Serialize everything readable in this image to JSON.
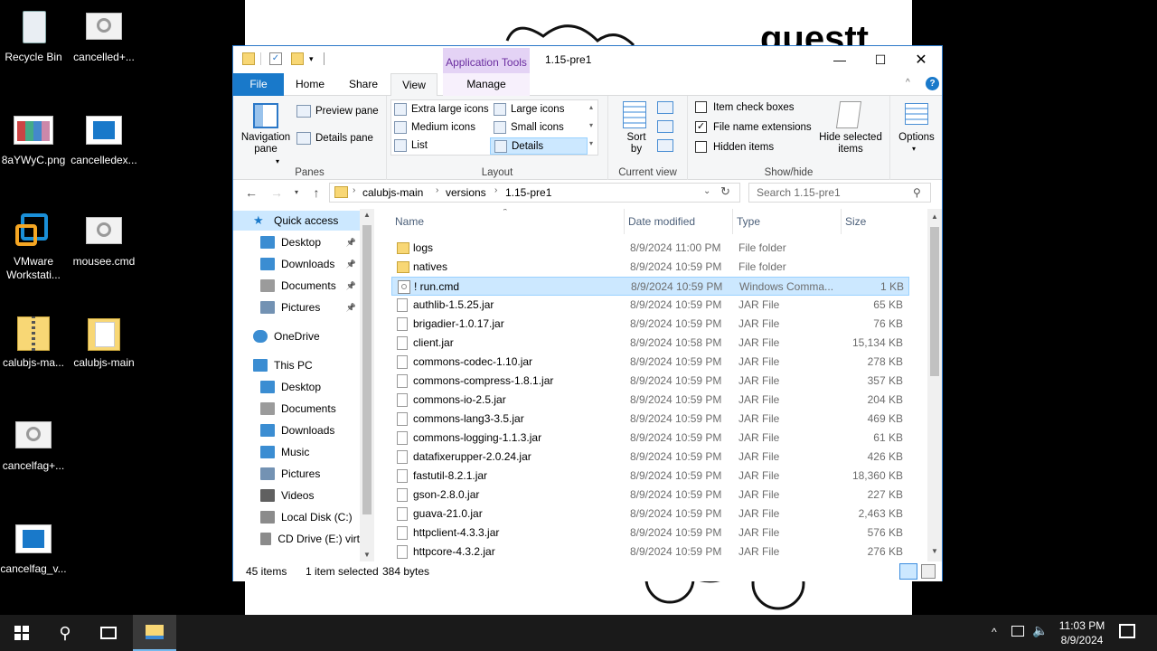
{
  "desktop": {
    "icons": [
      {
        "label": "Recycle Bin",
        "icon": "recycle-bin-icon"
      },
      {
        "label": "cancelled+...",
        "icon": "settings-file-icon"
      },
      {
        "label": "8aYWyC.png",
        "icon": "image-file-icon"
      },
      {
        "label": "cancelledex...",
        "icon": "window-app-icon"
      },
      {
        "label": "VMware Workstati...",
        "icon": "vmware-icon"
      },
      {
        "label": "mousee.cmd",
        "icon": "settings-file-icon"
      },
      {
        "label": "calubjs-ma...",
        "icon": "zip-folder-icon"
      },
      {
        "label": "calubjs-main",
        "icon": "folder-icon"
      },
      {
        "label": "cancelfag+...",
        "icon": "settings-file-icon"
      },
      {
        "label": "cancelfag_v...",
        "icon": "window-app-icon"
      }
    ],
    "wallpaper_text": "guestt"
  },
  "window": {
    "contextual_tab": "Application Tools",
    "title": "1.15-pre1",
    "tabs": {
      "file": "File",
      "home": "Home",
      "share": "Share",
      "view": "View",
      "manage": "Manage"
    },
    "ribbon": {
      "panes": {
        "label": "Panes",
        "navigation_pane": "Navigation pane",
        "preview_pane": "Preview pane",
        "details_pane": "Details pane"
      },
      "layout": {
        "label": "Layout",
        "extra_large_icons": "Extra large icons",
        "large_icons": "Large icons",
        "medium_icons": "Medium icons",
        "small_icons": "Small icons",
        "list": "List",
        "details": "Details",
        "selected": "Details"
      },
      "current_view": {
        "label": "Current view",
        "sort_by": "Sort by"
      },
      "show_hide": {
        "label": "Show/hide",
        "item_check_boxes": "Item check boxes",
        "item_check_boxes_checked": false,
        "file_name_extensions": "File name extensions",
        "file_name_extensions_checked": true,
        "hidden_items": "Hidden items",
        "hidden_items_checked": false,
        "hide_selected_items": "Hide selected items"
      },
      "options": "Options"
    },
    "address": {
      "crumbs": [
        "calubjs-main",
        "versions",
        "1.15-pre1"
      ],
      "search_placeholder": "Search 1.15-pre1"
    },
    "nav_pane": {
      "items": [
        {
          "label": "Quick access",
          "icon": "star-icon",
          "indent": 0,
          "pinned": false,
          "selected": true
        },
        {
          "label": "Desktop",
          "icon": "desktop-icon",
          "indent": 1,
          "pinned": true
        },
        {
          "label": "Downloads",
          "icon": "download-icon",
          "indent": 1,
          "pinned": true
        },
        {
          "label": "Documents",
          "icon": "document-icon",
          "indent": 1,
          "pinned": true
        },
        {
          "label": "Pictures",
          "icon": "pictures-icon",
          "indent": 1,
          "pinned": true
        },
        {
          "label": "OneDrive",
          "icon": "cloud-icon",
          "indent": 0,
          "pinned": false
        },
        {
          "label": "This PC",
          "icon": "pc-icon",
          "indent": 0,
          "pinned": false
        },
        {
          "label": "Desktop",
          "icon": "desktop-icon",
          "indent": 1,
          "pinned": false
        },
        {
          "label": "Documents",
          "icon": "document-icon",
          "indent": 1,
          "pinned": false
        },
        {
          "label": "Downloads",
          "icon": "download-icon",
          "indent": 1,
          "pinned": false
        },
        {
          "label": "Music",
          "icon": "music-icon",
          "indent": 1,
          "pinned": false
        },
        {
          "label": "Pictures",
          "icon": "pictures-icon",
          "indent": 1,
          "pinned": false
        },
        {
          "label": "Videos",
          "icon": "video-icon",
          "indent": 1,
          "pinned": false
        },
        {
          "label": "Local Disk (C:)",
          "icon": "disk-icon",
          "indent": 1,
          "pinned": false
        },
        {
          "label": "CD Drive (E:) virt",
          "icon": "cd-drive-icon",
          "indent": 1,
          "pinned": false
        }
      ]
    },
    "columns": {
      "name": "Name",
      "date": "Date modified",
      "type": "Type",
      "size": "Size"
    },
    "files": [
      {
        "name": "logs",
        "date": "8/9/2024 11:00 PM",
        "type": "File folder",
        "size": "",
        "kind": "folder"
      },
      {
        "name": "natives",
        "date": "8/9/2024 10:59 PM",
        "type": "File folder",
        "size": "",
        "kind": "folder"
      },
      {
        "name": "! run.cmd",
        "date": "8/9/2024 10:59 PM",
        "type": "Windows Comma...",
        "size": "1 KB",
        "kind": "cmd",
        "selected": true
      },
      {
        "name": "authlib-1.5.25.jar",
        "date": "8/9/2024 10:59 PM",
        "type": "JAR File",
        "size": "65 KB",
        "kind": "file"
      },
      {
        "name": "brigadier-1.0.17.jar",
        "date": "8/9/2024 10:59 PM",
        "type": "JAR File",
        "size": "76 KB",
        "kind": "file"
      },
      {
        "name": "client.jar",
        "date": "8/9/2024 10:58 PM",
        "type": "JAR File",
        "size": "15,134 KB",
        "kind": "file"
      },
      {
        "name": "commons-codec-1.10.jar",
        "date": "8/9/2024 10:59 PM",
        "type": "JAR File",
        "size": "278 KB",
        "kind": "file"
      },
      {
        "name": "commons-compress-1.8.1.jar",
        "date": "8/9/2024 10:59 PM",
        "type": "JAR File",
        "size": "357 KB",
        "kind": "file"
      },
      {
        "name": "commons-io-2.5.jar",
        "date": "8/9/2024 10:59 PM",
        "type": "JAR File",
        "size": "204 KB",
        "kind": "file"
      },
      {
        "name": "commons-lang3-3.5.jar",
        "date": "8/9/2024 10:59 PM",
        "type": "JAR File",
        "size": "469 KB",
        "kind": "file"
      },
      {
        "name": "commons-logging-1.1.3.jar",
        "date": "8/9/2024 10:59 PM",
        "type": "JAR File",
        "size": "61 KB",
        "kind": "file"
      },
      {
        "name": "datafixerupper-2.0.24.jar",
        "date": "8/9/2024 10:59 PM",
        "type": "JAR File",
        "size": "426 KB",
        "kind": "file"
      },
      {
        "name": "fastutil-8.2.1.jar",
        "date": "8/9/2024 10:59 PM",
        "type": "JAR File",
        "size": "18,360 KB",
        "kind": "file"
      },
      {
        "name": "gson-2.8.0.jar",
        "date": "8/9/2024 10:59 PM",
        "type": "JAR File",
        "size": "227 KB",
        "kind": "file"
      },
      {
        "name": "guava-21.0.jar",
        "date": "8/9/2024 10:59 PM",
        "type": "JAR File",
        "size": "2,463 KB",
        "kind": "file"
      },
      {
        "name": "httpclient-4.3.3.jar",
        "date": "8/9/2024 10:59 PM",
        "type": "JAR File",
        "size": "576 KB",
        "kind": "file"
      },
      {
        "name": "httpcore-4.3.2.jar",
        "date": "8/9/2024 10:59 PM",
        "type": "JAR File",
        "size": "276 KB",
        "kind": "file"
      }
    ],
    "status": {
      "count": "45 items",
      "selected": "1 item selected",
      "size": "384 bytes"
    }
  },
  "taskbar": {
    "time": "11:03 PM",
    "date": "8/9/2024"
  },
  "colors": {
    "file_tab": "#1979ca",
    "selection": "#cce8ff",
    "apptools": "#e4d3f5",
    "folder": "#f8d775"
  }
}
